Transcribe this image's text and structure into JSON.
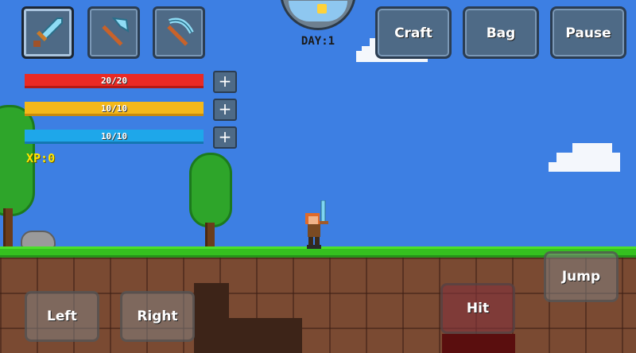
{
  "hud": {
    "tools": [
      {
        "name": "sword",
        "selected": true,
        "icon": "sword-icon"
      },
      {
        "name": "axe",
        "selected": false,
        "icon": "axe-icon"
      },
      {
        "name": "pickaxe",
        "selected": false,
        "icon": "pickaxe-icon"
      }
    ],
    "health": {
      "text": "20/20",
      "current": 20,
      "max": 20,
      "color": "#ea2a24"
    },
    "stamina": {
      "text": "10/10",
      "current": 10,
      "max": 10,
      "color": "#f4b81a"
    },
    "mana": {
      "text": "10/10",
      "current": 10,
      "max": 10,
      "color": "#1ea7ea"
    },
    "plus_label": "+",
    "xp": "XP:0",
    "day": "DAY:1"
  },
  "menu": {
    "craft": "Craft",
    "bag": "Bag",
    "pause": "Pause"
  },
  "controls": {
    "left": "Left",
    "right": "Right",
    "hit": "Hit",
    "jump": "Jump"
  },
  "colors": {
    "sky": "#3d7fe3",
    "grass": "#35c01f",
    "dirt": "#7a4a32"
  }
}
